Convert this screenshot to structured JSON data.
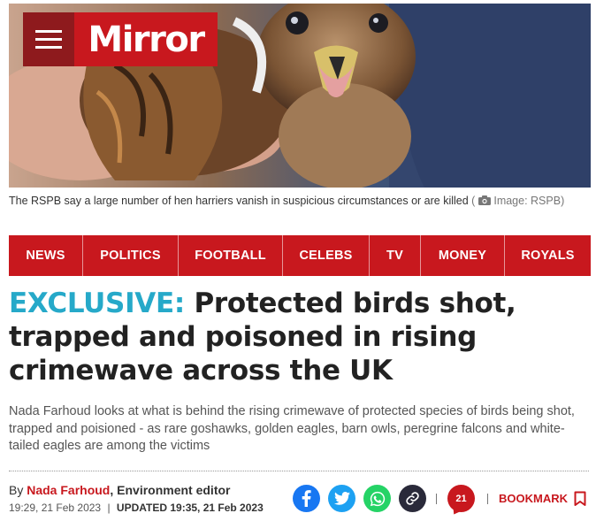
{
  "header": {
    "logo_text": "Mirror",
    "menu_icon": "hamburger-menu-icon",
    "brand_color": "#c8181e",
    "menu_bg_color": "#8e1a1d"
  },
  "hero": {
    "caption": "The RSPB say a large number of hen harriers vanish in suspicious circumstances or are killed",
    "credit": "Image: RSPB)",
    "credit_icon": "camera-icon"
  },
  "nav": {
    "items": [
      {
        "label": "NEWS"
      },
      {
        "label": "POLITICS"
      },
      {
        "label": "FOOTBALL"
      },
      {
        "label": "CELEBS"
      },
      {
        "label": "TV"
      },
      {
        "label": "MONEY"
      },
      {
        "label": "ROYALS"
      }
    ]
  },
  "article": {
    "exclusive_label": "EXCLUSIVE:",
    "headline": "Protected birds shot, trapped and poisoned in rising crimewave across the UK",
    "exclusive_color": "#26a9c9",
    "standfirst": "Nada Farhoud looks at what is behind the rising crimewave of protected species of birds being shot, trapped and poisioned - as rare goshawks, golden eagles, barn owls, peregrine falcons and white-tailed eagles are among the victims",
    "byline_prefix": "By",
    "author": "Nada Farhoud",
    "author_role": ", Environment editor",
    "published": "19:29, 21 Feb 2023",
    "date_separator": "|",
    "updated": "UPDATED 19:35, 21 Feb 2023"
  },
  "share": {
    "facebook_icon": "facebook-icon",
    "twitter_icon": "twitter-icon",
    "whatsapp_icon": "whatsapp-icon",
    "link_icon": "link-icon",
    "separator": "|",
    "comment_count": "21",
    "bookmark_label": "BOOKMARK",
    "bookmark_icon": "bookmark-icon",
    "facebook_color": "#1877f2",
    "twitter_color": "#1da1f2",
    "whatsapp_color": "#25d366",
    "link_color": "#2a2a3a"
  }
}
